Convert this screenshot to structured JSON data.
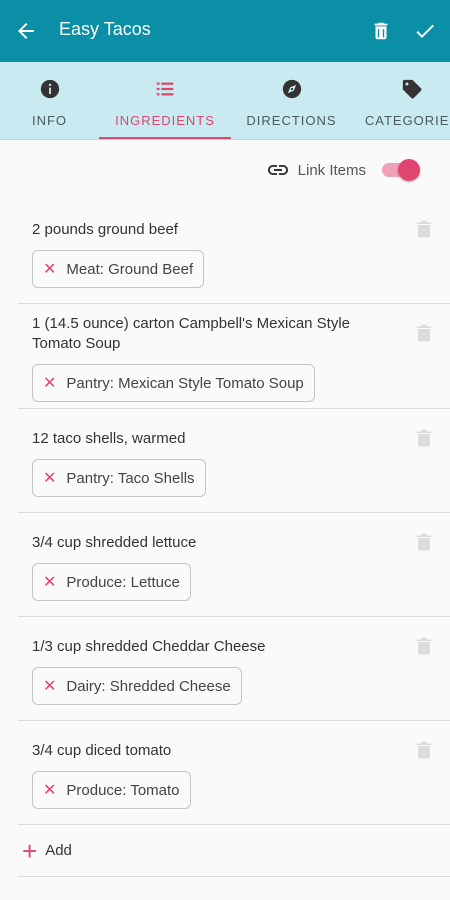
{
  "appbar": {
    "title": "Easy Tacos"
  },
  "tabs": [
    {
      "label": "INFO"
    },
    {
      "label": "INGREDIENTS"
    },
    {
      "label": "DIRECTIONS"
    },
    {
      "label": "CATEGORIES"
    }
  ],
  "link_items": {
    "label": "Link Items",
    "enabled": true
  },
  "ingredients": [
    {
      "text": "2 pounds ground beef",
      "link": "Meat: Ground Beef"
    },
    {
      "text": "1 (14.5 ounce) carton Campbell's Mexican Style Tomato Soup",
      "link": "Pantry: Mexican Style Tomato Soup"
    },
    {
      "text": "12 taco shells, warmed",
      "link": "Pantry: Taco Shells"
    },
    {
      "text": "3/4 cup shredded lettuce",
      "link": "Produce: Lettuce"
    },
    {
      "text": "1/3 cup shredded Cheddar Cheese",
      "link": "Dairy: Shredded Cheese"
    },
    {
      "text": "3/4 cup diced tomato",
      "link": "Produce: Tomato"
    }
  ],
  "add": {
    "label": "Add"
  },
  "colors": {
    "primary": "#0a8fa6",
    "accent": "#e0456f",
    "tab_bg": "#c8eaf0"
  }
}
